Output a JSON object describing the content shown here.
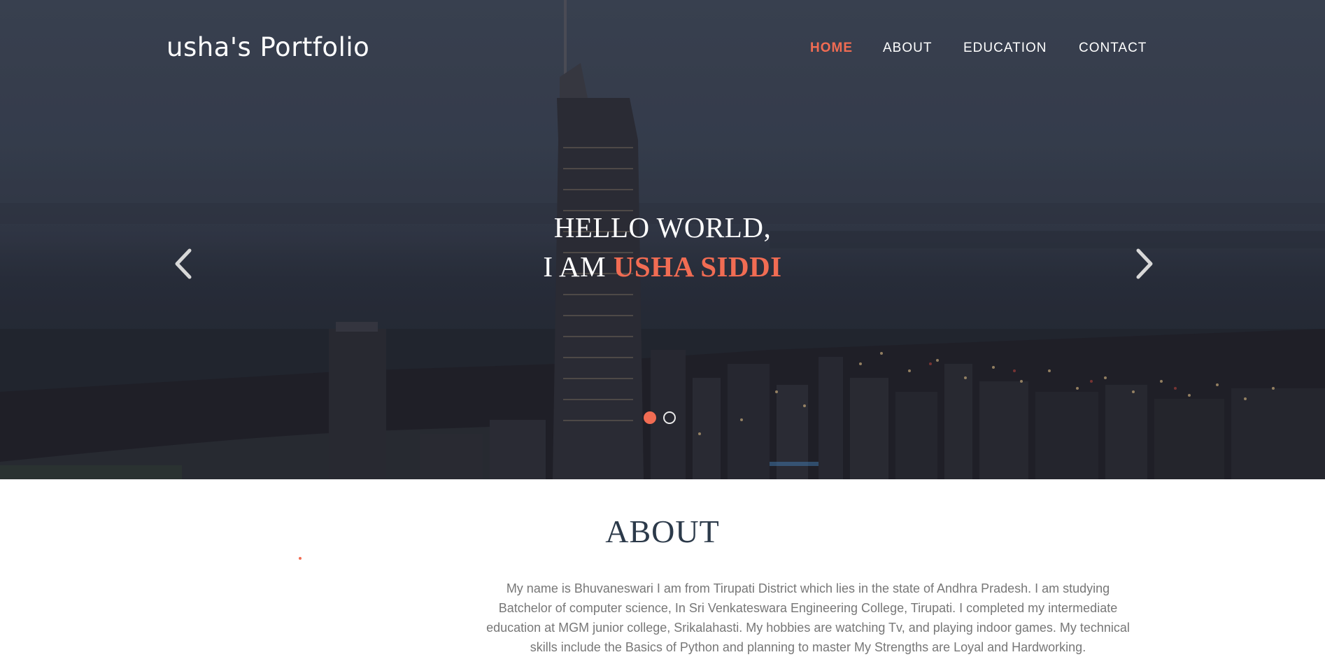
{
  "header": {
    "brand": "usha's Portfolio",
    "nav": [
      {
        "label": "HOME",
        "active": true
      },
      {
        "label": "ABOUT",
        "active": false
      },
      {
        "label": "EDUCATION",
        "active": false
      },
      {
        "label": "CONTACT",
        "active": false
      }
    ]
  },
  "hero": {
    "line1": "HELLO WORLD,",
    "line2_prefix": "I AM",
    "line2_name": "USHA SIDDI",
    "slides_total": 2,
    "slide_active": 1,
    "prev_icon": "chevron-left-icon",
    "next_icon": "chevron-right-icon"
  },
  "about": {
    "title": "ABOUT",
    "text": "My name is Bhuvaneswari I am from Tirupati District which lies in the state of Andhra Pradesh. I am studying Batchelor of computer science, In Sri Venkateswara Engineering College, Tirupati. I completed my intermediate education at MGM junior college, Srikalahasti. My hobbies are watching Tv, and playing indoor games. My technical skills include the Basics of Python and planning to master My Strengths are Loyal and Hardworking."
  },
  "colors": {
    "accent": "#f16c53",
    "heading": "#2c3a4a",
    "body_text": "#777777"
  }
}
